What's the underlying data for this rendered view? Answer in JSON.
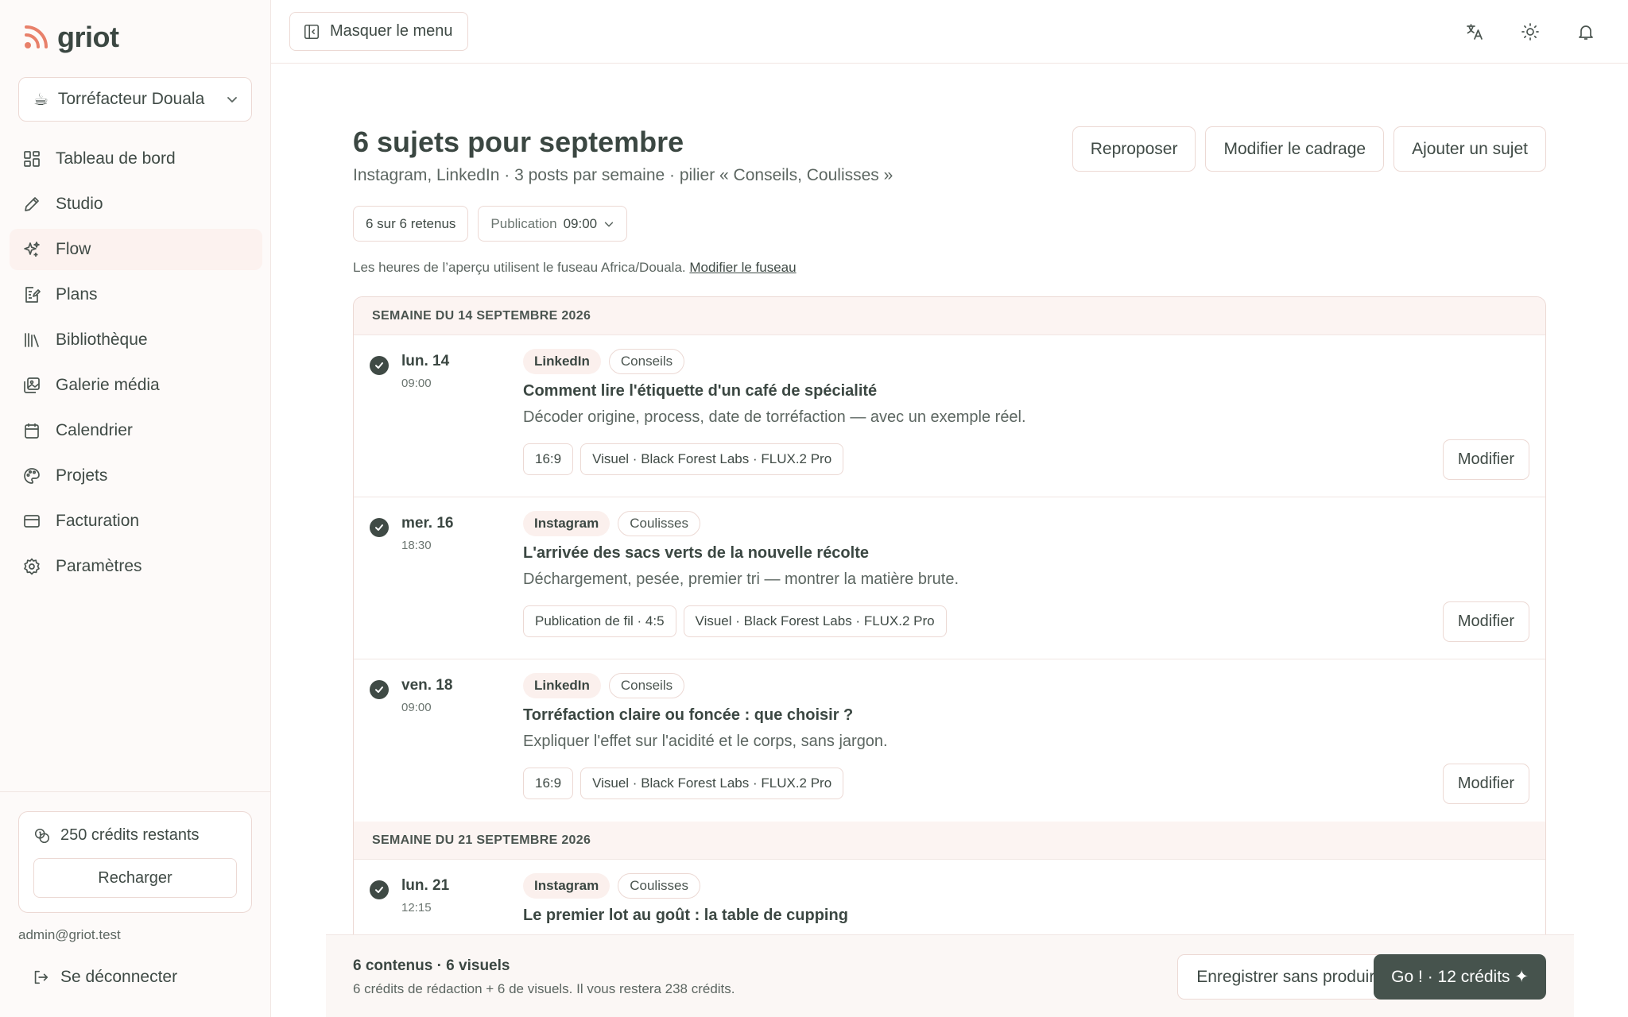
{
  "app": {
    "name": "griot"
  },
  "workspace": {
    "emoji": "☕",
    "name": "Torréfacteur Douala"
  },
  "sidebar": {
    "items": [
      {
        "label": "Tableau de bord",
        "icon": "dashboard-icon"
      },
      {
        "label": "Studio",
        "icon": "pencil-icon"
      },
      {
        "label": "Flow",
        "icon": "sparkles-icon"
      },
      {
        "label": "Plans",
        "icon": "plan-icon"
      },
      {
        "label": "Bibliothèque",
        "icon": "library-icon"
      },
      {
        "label": "Galerie média",
        "icon": "gallery-icon"
      },
      {
        "label": "Calendrier",
        "icon": "calendar-icon"
      },
      {
        "label": "Projets",
        "icon": "palette-icon"
      },
      {
        "label": "Facturation",
        "icon": "card-icon"
      },
      {
        "label": "Paramètres",
        "icon": "gear-icon"
      }
    ],
    "active": "Flow",
    "credits": {
      "text": "250 crédits restants",
      "recharge_label": "Recharger"
    },
    "user_email": "admin@griot.test",
    "logout_label": "Se déconnecter"
  },
  "topbar": {
    "hide_menu_label": "Masquer le menu"
  },
  "header": {
    "title": "6 sujets pour septembre",
    "subtitle": "Instagram, LinkedIn · 3 posts par semaine · pilier « Conseils, Coulisses »",
    "actions": {
      "repropose": "Reproposer",
      "edit_frame": "Modifier le cadrage",
      "add_topic": "Ajouter un sujet"
    },
    "filters": {
      "retained": "6 sur 6 retenus",
      "publication_label": "Publication",
      "publication_time": "09:00"
    },
    "tz_note": "Les heures de l’aperçu utilisent le fuseau Africa/Douala.",
    "tz_link": "Modifier le fuseau"
  },
  "weeks": [
    {
      "label": "SEMAINE DU 14 SEPTEMBRE 2026",
      "items": [
        {
          "date": "lun. 14",
          "time": "09:00",
          "platform": "LinkedIn",
          "pillar": "Conseils",
          "title": "Comment lire l'étiquette d'un café de spécialité",
          "desc": "Décoder origine, process, date de torréfaction — avec un exemple réel.",
          "format": "16:9",
          "visual": "Visuel · Black Forest Labs · FLUX.2 Pro"
        },
        {
          "date": "mer. 16",
          "time": "18:30",
          "platform": "Instagram",
          "pillar": "Coulisses",
          "title": "L'arrivée des sacs verts de la nouvelle récolte",
          "desc": "Déchargement, pesée, premier tri — montrer la matière brute.",
          "format": "Publication de fil · 4:5",
          "visual": "Visuel · Black Forest Labs · FLUX.2 Pro"
        },
        {
          "date": "ven. 18",
          "time": "09:00",
          "platform": "LinkedIn",
          "pillar": "Conseils",
          "title": "Torréfaction claire ou foncée : que choisir ?",
          "desc": "Expliquer l'effet sur l'acidité et le corps, sans jargon.",
          "format": "16:9",
          "visual": "Visuel · Black Forest Labs · FLUX.2 Pro"
        }
      ]
    },
    {
      "label": "SEMAINE DU 21 SEPTEMBRE 2026",
      "items": [
        {
          "date": "lun. 21",
          "time": "12:15",
          "platform": "Instagram",
          "pillar": "Coulisses",
          "title": "Le premier lot au goût : la table de cupping"
        }
      ]
    }
  ],
  "edit_label": "Modifier",
  "footer": {
    "summary": "6 contenus · 6 visuels",
    "detail": "6 crédits de rédaction + 6 de visuels. Il vous restera 238 crédits.",
    "save_label": "Enregistrer sans produire",
    "go_label": "Go ! · 12 crédits ✦"
  }
}
